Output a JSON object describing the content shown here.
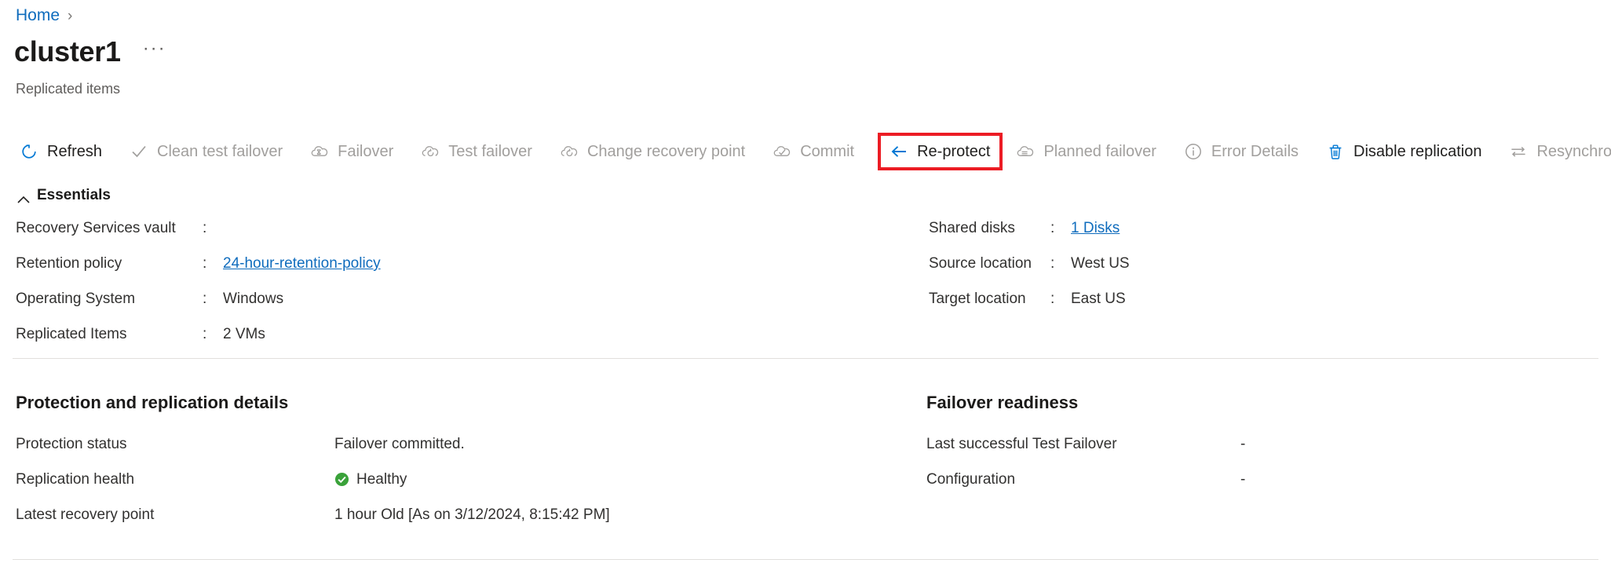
{
  "breadcrumb": {
    "home_label": "Home",
    "separator": "›"
  },
  "header": {
    "title": "cluster1",
    "subtitle": "Replicated items",
    "more_label": "···"
  },
  "commandbar": {
    "items": [
      {
        "label": "Refresh",
        "icon": "refresh-icon",
        "enabled": true,
        "highlighted": false
      },
      {
        "label": "Clean test failover",
        "icon": "checkmark-icon",
        "enabled": false,
        "highlighted": false
      },
      {
        "label": "Failover",
        "icon": "cloud-hourglass-icon",
        "enabled": false,
        "highlighted": false
      },
      {
        "label": "Test failover",
        "icon": "cloud-refresh-icon",
        "enabled": false,
        "highlighted": false
      },
      {
        "label": "Change recovery point",
        "icon": "cloud-refresh-icon",
        "enabled": false,
        "highlighted": false
      },
      {
        "label": "Commit",
        "icon": "cloud-check-icon",
        "enabled": false,
        "highlighted": false
      },
      {
        "label": "Re-protect",
        "icon": "arrow-left-icon",
        "enabled": true,
        "highlighted": true
      },
      {
        "label": "Planned failover",
        "icon": "cloud-lines-icon",
        "enabled": false,
        "highlighted": false
      },
      {
        "label": "Error Details",
        "icon": "info-circle-icon",
        "enabled": false,
        "highlighted": false
      },
      {
        "label": "Disable replication",
        "icon": "trash-icon",
        "enabled": true,
        "highlighted": false
      },
      {
        "label": "Resynchronize",
        "icon": "sync-arrows-icon",
        "enabled": false,
        "highlighted": false
      }
    ]
  },
  "essentials": {
    "section_label": "Essentials",
    "left": [
      {
        "label": "Recovery Services vault",
        "colon": ":",
        "value": "",
        "link": false
      },
      {
        "label": "Retention policy",
        "colon": ":",
        "value": "24-hour-retention-policy",
        "link": true
      },
      {
        "label": "Operating System",
        "colon": ":",
        "value": "Windows",
        "link": false
      },
      {
        "label": "Replicated Items",
        "colon": ":",
        "value": "2 VMs",
        "link": false
      }
    ],
    "right": [
      {
        "label": "Shared disks",
        "colon": ":",
        "value": "1 Disks",
        "link": true
      },
      {
        "label": "Source location",
        "colon": ":",
        "value": "West US",
        "link": false
      },
      {
        "label": "Target location",
        "colon": ":",
        "value": "East US",
        "link": false
      }
    ]
  },
  "protection_panel": {
    "title": "Protection and replication details",
    "rows": [
      {
        "label": "Protection status",
        "value": "Failover committed.",
        "status_icon": ""
      },
      {
        "label": "Replication health",
        "value": "Healthy",
        "status_icon": "health-ok-icon"
      },
      {
        "label": "Latest recovery point",
        "value": "1 hour Old [As on 3/12/2024, 8:15:42 PM]",
        "status_icon": ""
      }
    ]
  },
  "failover_panel": {
    "title": "Failover readiness",
    "rows": [
      {
        "label": "Last successful Test Failover",
        "value": "-"
      },
      {
        "label": "Configuration",
        "value": "-"
      }
    ]
  },
  "colors": {
    "accent_blue": "#0f6cbd",
    "icon_blue": "#0078d4",
    "disabled_gray": "#a19f9d",
    "text_dark": "#201f1e",
    "highlight_red": "#ec1c24",
    "health_green": "#3aa23a",
    "divider": "#e1dfdd"
  }
}
